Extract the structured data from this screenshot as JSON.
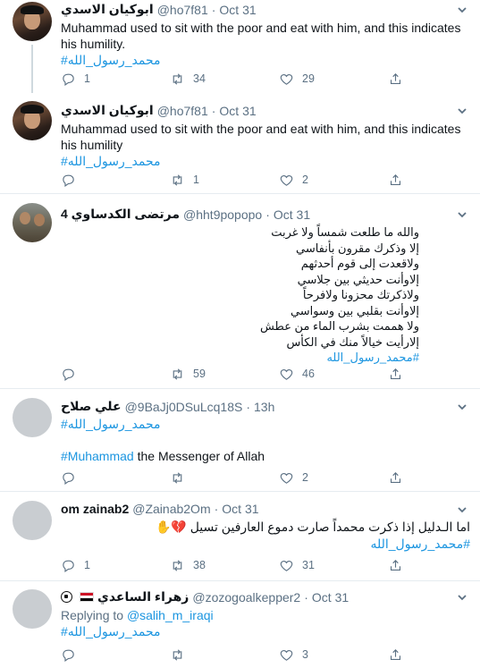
{
  "tweets": [
    {
      "name": "ابوكيان الاسدي",
      "handle": "@ho7f81",
      "dot": "·",
      "time": "Oct 31",
      "text": "Muhammad used to sit with the poor and eat with him, and this indicates his humility.",
      "hashtag": "#محمد_رسول_الله",
      "replies": "1",
      "retweets": "34",
      "likes": "29"
    },
    {
      "name": "ابوكيان الاسدي",
      "handle": "@ho7f81",
      "dot": "·",
      "time": "Oct 31",
      "text": "Muhammad used to sit with the poor and eat with him, and this indicates his humility",
      "hashtag": "#محمد_رسول_الله",
      "replies": "",
      "retweets": "1",
      "likes": "2"
    },
    {
      "name": "مرتضى الكدساوي 4",
      "handle": "@hht9popopo",
      "dot": "·",
      "time": "Oct 31",
      "lines": [
        "والله ما طلعت شمساً ولا غربت",
        "إلا وذكرك مقرون بأنفاسي",
        "ولاقعدت إلى قوم أحدثهم",
        "إلاوأنت حديثي بين جلاسي",
        "ولاذكرتك محزونا ولافرحاً",
        "إلاوأنت بقلبي بين وسواسي",
        "ولا هممت بشرب الماء من عطش",
        "إلارأيت خيالاً منك في الكأس"
      ],
      "hashtag": "#محمد_رسول_الله",
      "replies": "",
      "retweets": "59",
      "likes": "46"
    },
    {
      "name": "علي صلاح",
      "handle": "@9BaJj0DSuLcq18S",
      "dot": "·",
      "time": "13h",
      "hashtag": "#محمد_رسول_الله",
      "hashtag2": "#Muhammad",
      "text2": " the Messenger of Allah",
      "replies": "",
      "retweets": "",
      "likes": "2"
    },
    {
      "name": "om zainab2",
      "handle": "@Zainab2Om",
      "dot": "·",
      "time": "Oct 31",
      "text": "اما الـدليل إذا ذكرت محمداً صارت دموع العارفين تسيل",
      "emoji": "💔✋",
      "hashtag": "#محمد_رسول_الله",
      "replies": "1",
      "retweets": "38",
      "likes": "31"
    },
    {
      "name": "زهراء الساعدي",
      "handle": "@zozogoalkepper2",
      "dot": "·",
      "time": "Oct 31",
      "replying_prefix": "Replying to ",
      "replying_handle": "@salih_m_iraqi",
      "hashtag": "#محمد_رسول_الله",
      "replies": "",
      "retweets": "",
      "likes": "3"
    }
  ],
  "colors": {
    "accent": "#1b95e0",
    "muted": "#5b7083",
    "text": "#0f1419",
    "divider": "#e6ecf0"
  }
}
